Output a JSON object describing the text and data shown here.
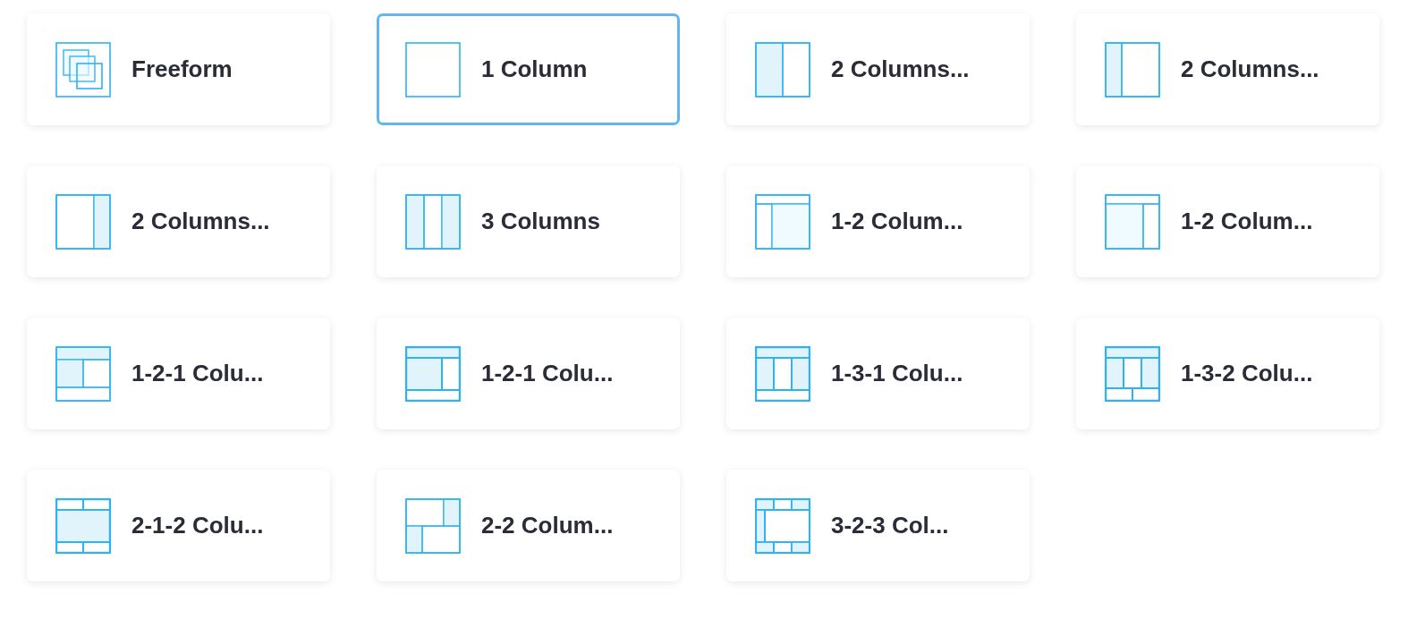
{
  "layouts": [
    {
      "label": "Freeform",
      "selected": false,
      "kind": "freeform"
    },
    {
      "label": "1 Column",
      "selected": true,
      "kind": "one"
    },
    {
      "label": "2 Columns...",
      "selected": false,
      "kind": "twohalf"
    },
    {
      "label": "2 Columns...",
      "selected": false,
      "kind": "twoleft"
    },
    {
      "label": "2 Columns...",
      "selected": false,
      "kind": "tworight"
    },
    {
      "label": "3 Columns",
      "selected": false,
      "kind": "three"
    },
    {
      "label": "1-2 Colum...",
      "selected": false,
      "kind": "onetwoleft"
    },
    {
      "label": "1-2 Colum...",
      "selected": false,
      "kind": "onetworight"
    },
    {
      "label": "1-2-1 Colu...",
      "selected": false,
      "kind": "onetwoone"
    },
    {
      "label": "1-2-1 Colu...",
      "selected": false,
      "kind": "onetwoonewide"
    },
    {
      "label": "1-3-1 Colu...",
      "selected": false,
      "kind": "onethreeone"
    },
    {
      "label": "1-3-2 Colu...",
      "selected": false,
      "kind": "onethreetwo"
    },
    {
      "label": "2-1-2 Colu...",
      "selected": false,
      "kind": "twoonetwo"
    },
    {
      "label": "2-2 Colum...",
      "selected": false,
      "kind": "twotwo"
    },
    {
      "label": "3-2-3 Col...",
      "selected": false,
      "kind": "threetwothree"
    }
  ]
}
